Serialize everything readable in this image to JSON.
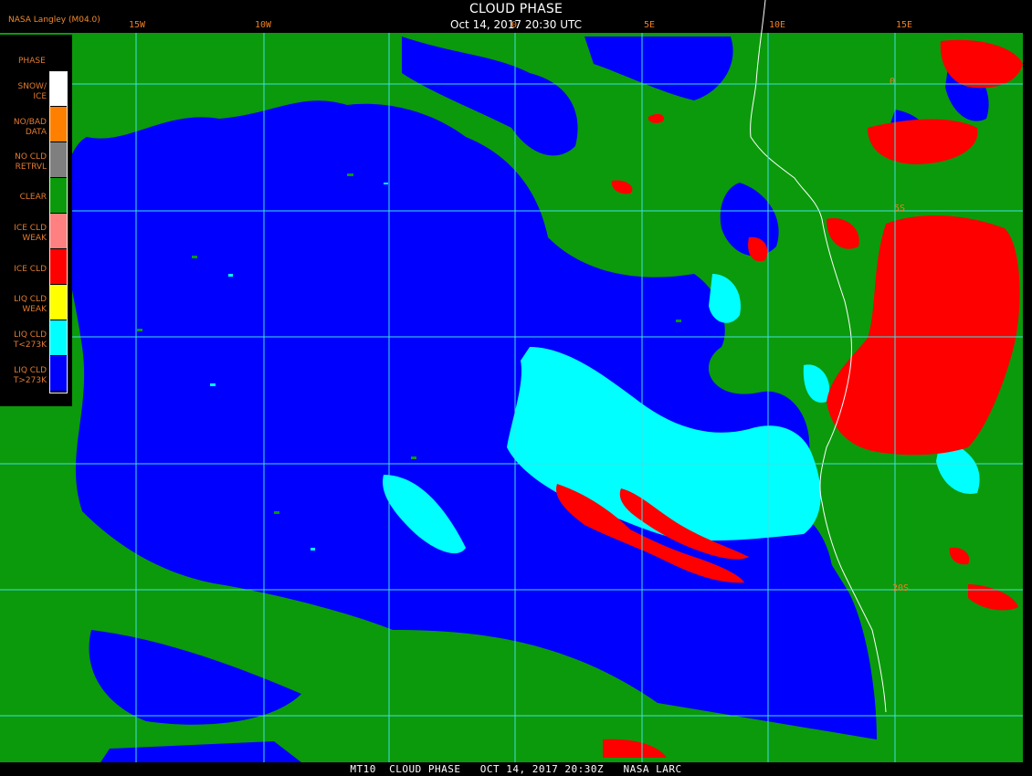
{
  "header": {
    "title": "CLOUD PHASE",
    "timestamp": "Oct 14, 2017 20:30 UTC",
    "source": "NASA Langley (M04.0)"
  },
  "footer": {
    "caption": "MT10  CLOUD PHASE   OCT 14, 2017 20:30Z   NASA LARC"
  },
  "grid": {
    "longitude_labels": [
      "15W",
      "10W",
      "0",
      "5E",
      "10E",
      "15E"
    ],
    "latitude_labels": [
      "0",
      "5S",
      "20S"
    ]
  },
  "legend": {
    "title": "PHASE",
    "items": [
      {
        "label": "SNOW/\nICE",
        "color": "#ffffff"
      },
      {
        "label": "NO/BAD\nDATA",
        "color": "#ff7f00"
      },
      {
        "label": "NO CLD\nRETRVL",
        "color": "#7f7f7f"
      },
      {
        "label": "CLEAR",
        "color": "#0b9a0b"
      },
      {
        "label": "ICE CLD\nWEAK",
        "color": "#ff8080"
      },
      {
        "label": "ICE CLD",
        "color": "#ff0000"
      },
      {
        "label": "LIQ CLD\nWEAK",
        "color": "#ffff00"
      },
      {
        "label": "LIQ CLD\nT<273K",
        "color": "#00ffff"
      },
      {
        "label": "LIQ CLD\nT>273K",
        "color": "#0000ff"
      }
    ]
  },
  "colors": {
    "grid": "#40e0e0",
    "coastline": "#ffffff",
    "label": "#f07d22",
    "clear": "#0b9a0b",
    "liquid_warm": "#0000ff",
    "liquid_cold": "#00ffff",
    "ice": "#ff0000"
  }
}
